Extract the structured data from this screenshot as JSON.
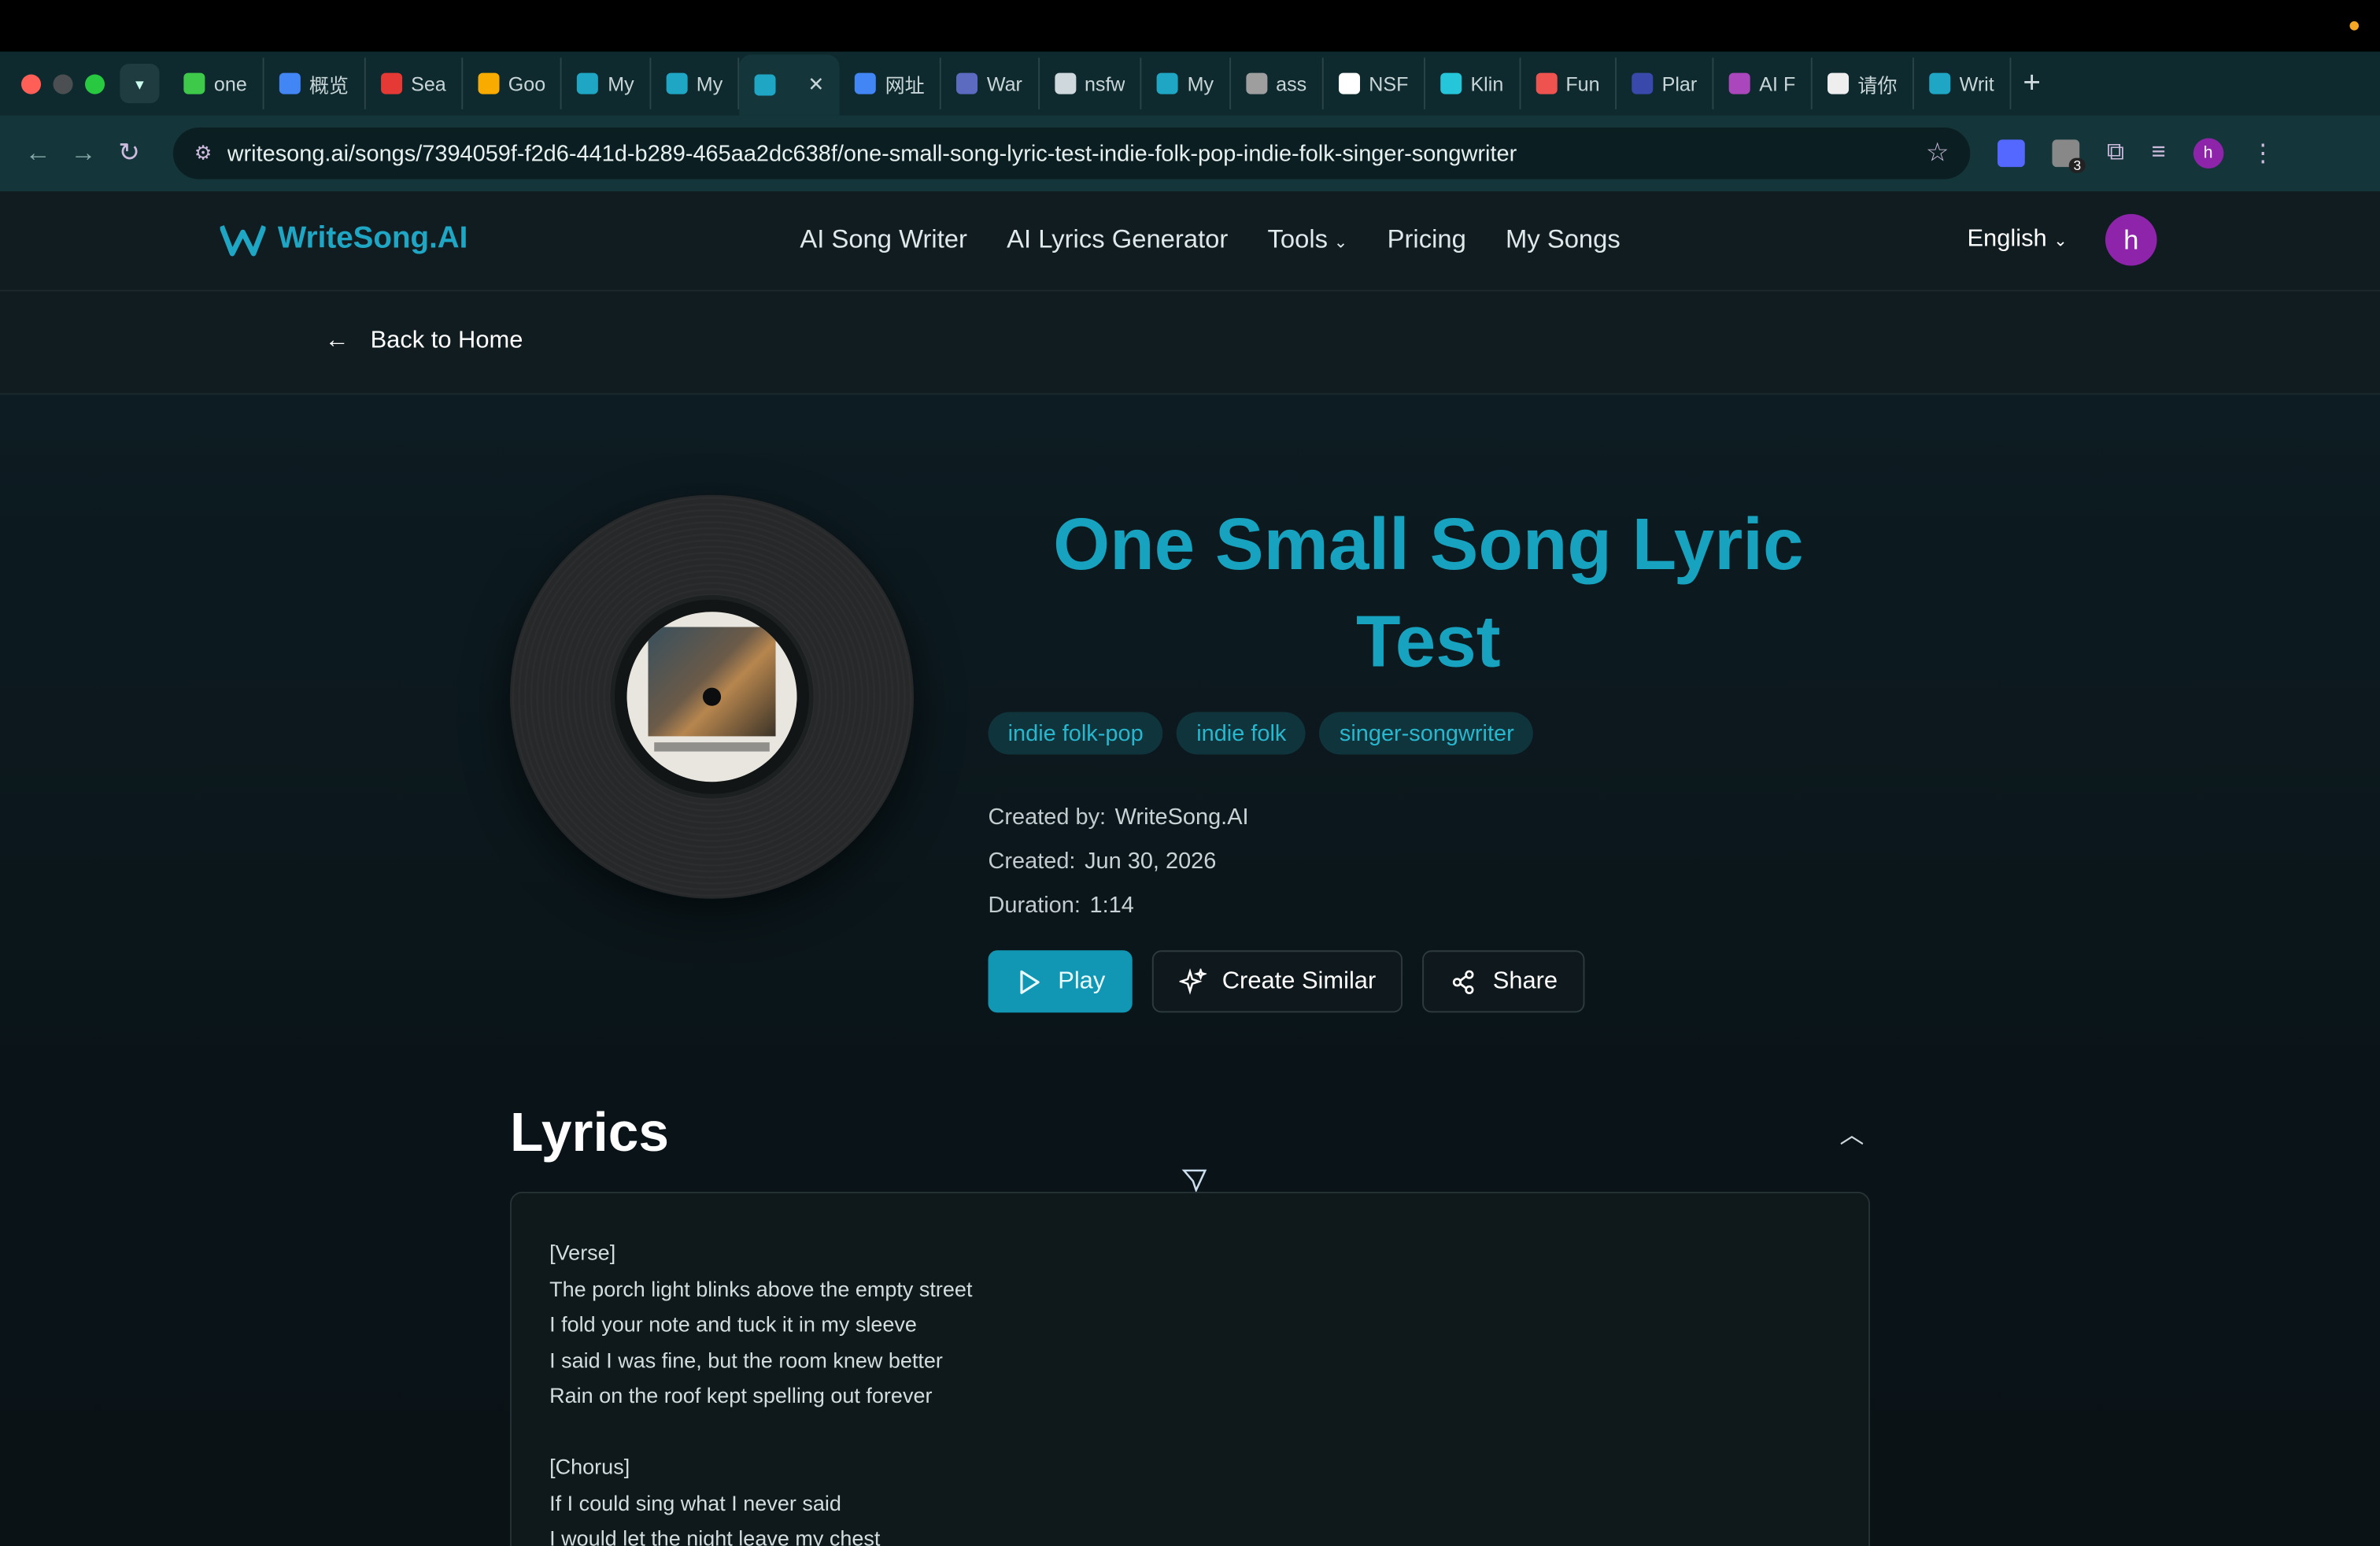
{
  "browser": {
    "tabs": [
      {
        "label": "one",
        "color": "#3ec94a"
      },
      {
        "label": "概览",
        "color": "#4285f4"
      },
      {
        "label": "Sea",
        "color": "#e53935"
      },
      {
        "label": "Goo",
        "color": "#f9ab00"
      },
      {
        "label": "My",
        "color": "#1fa6c4"
      },
      {
        "label": "My",
        "color": "#1fa6c4"
      },
      {
        "label": "",
        "color": "#1fa6c4",
        "active": true
      },
      {
        "label": "网址",
        "color": "#4285f4"
      },
      {
        "label": "War",
        "color": "#5c6bc0"
      },
      {
        "label": "nsfw",
        "color": "#cfd8dc"
      },
      {
        "label": "My",
        "color": "#1fa6c4"
      },
      {
        "label": "ass",
        "color": "#9e9e9e"
      },
      {
        "label": "NSF",
        "color": "#ffffff"
      },
      {
        "label": "Klin",
        "color": "#26c6da"
      },
      {
        "label": "Fun",
        "color": "#ef5350"
      },
      {
        "label": "Plar",
        "color": "#3949ab"
      },
      {
        "label": "AI F",
        "color": "#ab47bc"
      },
      {
        "label": "请你",
        "color": "#eeeeee"
      },
      {
        "label": "Writ",
        "color": "#1fa6c4"
      }
    ],
    "url": "writesong.ai/songs/7394059f-f2d6-441d-b289-465aa2dc638f/one-small-song-lyric-test-indie-folk-pop-indie-folk-singer-songwriter",
    "extension_badge": "3",
    "profile_initial": "h"
  },
  "site": {
    "logo_text": "WriteSong.AI",
    "nav": [
      "AI Song Writer",
      "AI Lyrics Generator",
      "Tools",
      "Pricing",
      "My Songs"
    ],
    "language": "English",
    "avatar_initial": "h",
    "back_label": "Back to Home"
  },
  "song": {
    "title": "One Small Song Lyric Test",
    "tags": [
      "indie folk-pop",
      "indie folk",
      "singer-songwriter"
    ],
    "created_by_label": "Created by:",
    "created_by": "WriteSong.AI",
    "created_label": "Created:",
    "created": "Jun 30, 2026",
    "duration_label": "Duration:",
    "duration": "1:14",
    "play_label": "Play",
    "create_similar_label": "Create Similar",
    "share_label": "Share"
  },
  "lyrics": {
    "heading": "Lyrics",
    "lines": [
      "[Verse]",
      "The porch light blinks above the empty street",
      "I fold your note and tuck it in my sleeve",
      "I said I was fine, but the room knew better",
      "Rain on the roof kept spelling out forever",
      "",
      "[Chorus]",
      "If I could sing what I never said",
      "I would let the night leave my chest"
    ]
  },
  "colors": {
    "accent": "#17a3bf",
    "play_button": "#1196b4",
    "avatar": "#8e24aa"
  }
}
